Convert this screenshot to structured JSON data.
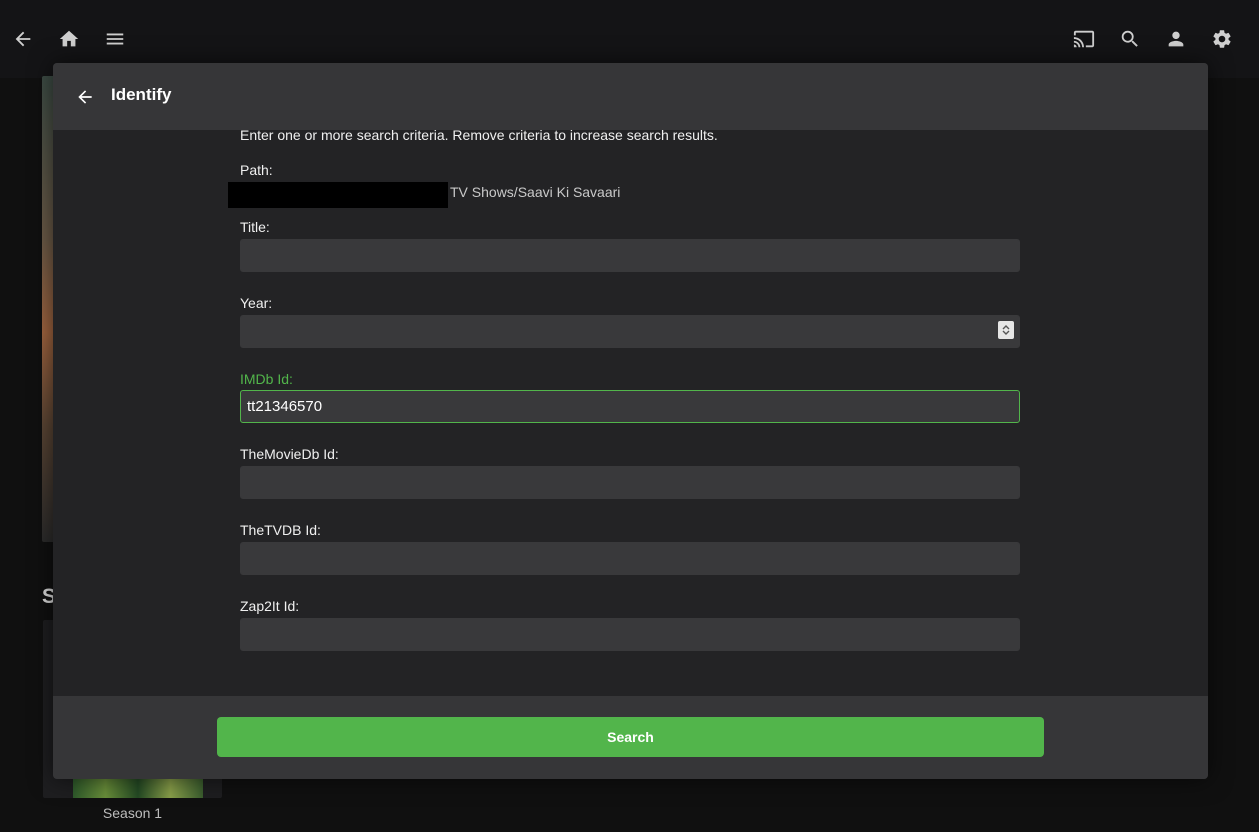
{
  "topbar": {
    "left_icons": [
      "back-arrow-icon",
      "home-icon",
      "menu-icon"
    ],
    "right_icons": [
      "cast-icon",
      "search-icon",
      "user-icon",
      "settings-icon"
    ]
  },
  "background": {
    "section_letter": "S",
    "season_label": "Season 1"
  },
  "dialog": {
    "title": "Identify",
    "intro": "Enter one or more search criteria. Remove criteria to increase search results.",
    "path": {
      "label": "Path:",
      "value": "TV Shows/Saavi Ki Savaari"
    },
    "fields": {
      "title": {
        "label": "Title:",
        "value": ""
      },
      "year": {
        "label": "Year:",
        "value": ""
      },
      "imdb": {
        "label": "IMDb Id:",
        "value": "tt21346570"
      },
      "tmdb": {
        "label": "TheMovieDb Id:",
        "value": ""
      },
      "tvdb": {
        "label": "TheTVDB Id:",
        "value": ""
      },
      "zap2it": {
        "label": "Zap2It Id:",
        "value": ""
      }
    },
    "search_label": "Search",
    "accent_color": "#52b54b"
  }
}
